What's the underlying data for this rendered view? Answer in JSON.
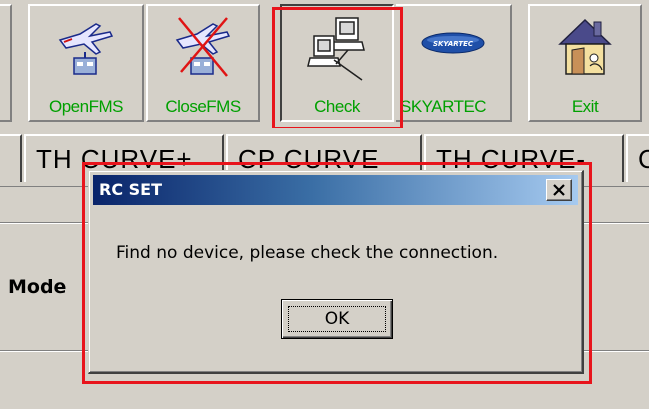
{
  "toolbar": {
    "buttons": [
      {
        "label": "OpenFMS",
        "icon": "airplane-plug-icon"
      },
      {
        "label": "CloseFMS",
        "icon": "airplane-plug-crossed-icon"
      },
      {
        "label": "Check",
        "icon": "computers-connection-icon"
      },
      {
        "label": "SKYARTEC",
        "icon": "skyartec-logo-icon",
        "logo_text": "SKYARTEC"
      },
      {
        "label": "Exit",
        "icon": "house-exit-icon"
      }
    ],
    "label_color": "#00a000"
  },
  "tabs": [
    {
      "label": "TH CURVE+"
    },
    {
      "label": "CP CURVE"
    },
    {
      "label": "TH CURVE-"
    },
    {
      "label": "C"
    }
  ],
  "body": {
    "mode_label": "Mode"
  },
  "dialog": {
    "title": "RC SET",
    "close_label": "×",
    "message": "Find no device, please check the connection.",
    "ok_label": "OK"
  },
  "colors": {
    "highlight": "#e8141c",
    "title_start": "#0a246a",
    "title_end": "#a6caf0",
    "face": "#d4d0c8"
  }
}
